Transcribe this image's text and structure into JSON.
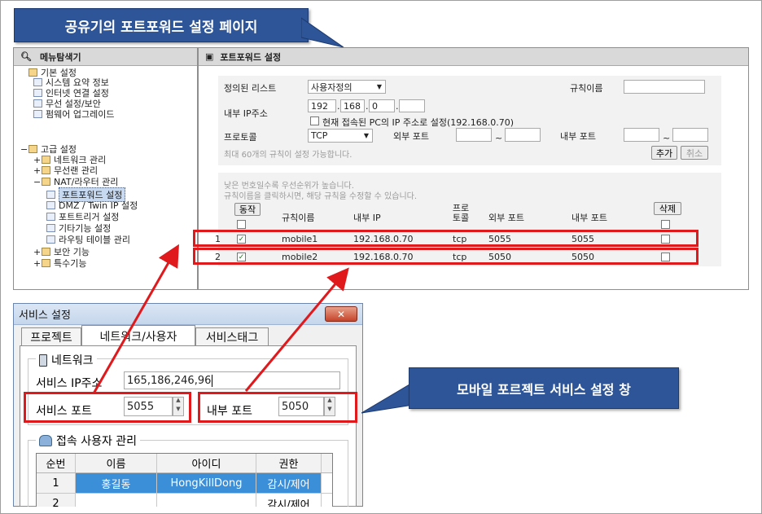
{
  "callouts": {
    "top": "공유기의 포트포워드 설정 페이지",
    "mobile": "모바일 포르젝트 서비스 설정 창"
  },
  "left_panel": {
    "title": "메뉴탐색기",
    "items": [
      {
        "label": "기본 설정",
        "icon": "folder-icon"
      },
      {
        "label": "시스템 요약 정보",
        "icon": "document-icon"
      },
      {
        "label": "인터넷 연결 설정",
        "icon": "document-icon"
      },
      {
        "label": "무선 설정/보안",
        "icon": "document-icon"
      },
      {
        "label": "펌웨어 업그레이드",
        "icon": "document-icon"
      },
      {
        "label": "고급 설정",
        "icon": "folder-icon"
      },
      {
        "label": "네트워크 관리",
        "icon": "folder-icon"
      },
      {
        "label": "무선랜 관리",
        "icon": "folder-icon"
      },
      {
        "label": "NAT/라우터 관리",
        "icon": "folder-icon"
      },
      {
        "label": "포트포워드 설정",
        "icon": "document-icon"
      },
      {
        "label": "DMZ / Twin IP 설정",
        "icon": "document-icon"
      },
      {
        "label": "포트트리거 설정",
        "icon": "document-icon"
      },
      {
        "label": "기타기능 설정",
        "icon": "document-icon"
      },
      {
        "label": "라우팅 테이블 관리",
        "icon": "document-icon"
      },
      {
        "label": "보안 기능",
        "icon": "folder-icon"
      },
      {
        "label": "특수기능",
        "icon": "folder-icon"
      }
    ]
  },
  "right_panel": {
    "title": "포트포워드 설정",
    "preset_label": "정의된 리스트",
    "preset_value": "사용자정의",
    "rule_name_label": "규칙이름",
    "internal_ip_label": "내부 IP주소",
    "ip_parts": [
      "192",
      "168",
      "0",
      ""
    ],
    "current_pc_label": "현재 접속된 PC의 IP 주소로 설정(192.168.0.70)",
    "protocol_label": "프로토콜",
    "protocol_value": "TCP",
    "external_port_label": "외부 포트",
    "internal_port_label": "내부 포트",
    "max_note": "최대 60개의 규칙이 설정 가능합니다.",
    "add_button": "추가",
    "cancel_button": "취소",
    "priority_note": "낮은 번호일수록 우선순위가 높습니다.",
    "edit_note": "규칙이름을 클릭하시면, 해당 규칙을 수정할 수 있습니다.",
    "action_button": "동작",
    "delete_button": "삭제",
    "columns": {
      "name": "규칙이름",
      "ip": "내부 IP",
      "proto": "프로토콜",
      "ext": "외부 포트",
      "int": "내부 포트"
    },
    "rules": [
      {
        "no": "1",
        "name": "mobile1",
        "ip": "192.168.0.70",
        "proto": "tcp",
        "ext": "5055",
        "int": "5055"
      },
      {
        "no": "2",
        "name": "mobile2",
        "ip": "192.168.0.70",
        "proto": "tcp",
        "ext": "5050",
        "int": "5050"
      }
    ]
  },
  "dialog": {
    "title": "서비스 설정",
    "tabs": [
      "프로젝트",
      "네트워크/사용자",
      "서비스태그"
    ],
    "network_group": "네트워크",
    "service_ip_label": "서비스 IP주소",
    "service_ip_value": "165,186,246,96",
    "service_port_label": "서비스 포트",
    "service_port_value": "5055",
    "internal_port_label": "내부 포트",
    "internal_port_value": "5050",
    "user_group": "접속 사용자 관리",
    "user_columns": [
      "순번",
      "이름",
      "아이디",
      "권한"
    ],
    "users": [
      {
        "no": "1",
        "name": "홍길동",
        "id": "HongKillDong",
        "role": "감시/제어"
      },
      {
        "no": "2",
        "name": "",
        "id": "",
        "role": "감시/제어"
      }
    ]
  },
  "colors": {
    "callout": "#2e5597",
    "highlight_red": "#e0191d",
    "selection_blue": "#3b8fd9"
  }
}
